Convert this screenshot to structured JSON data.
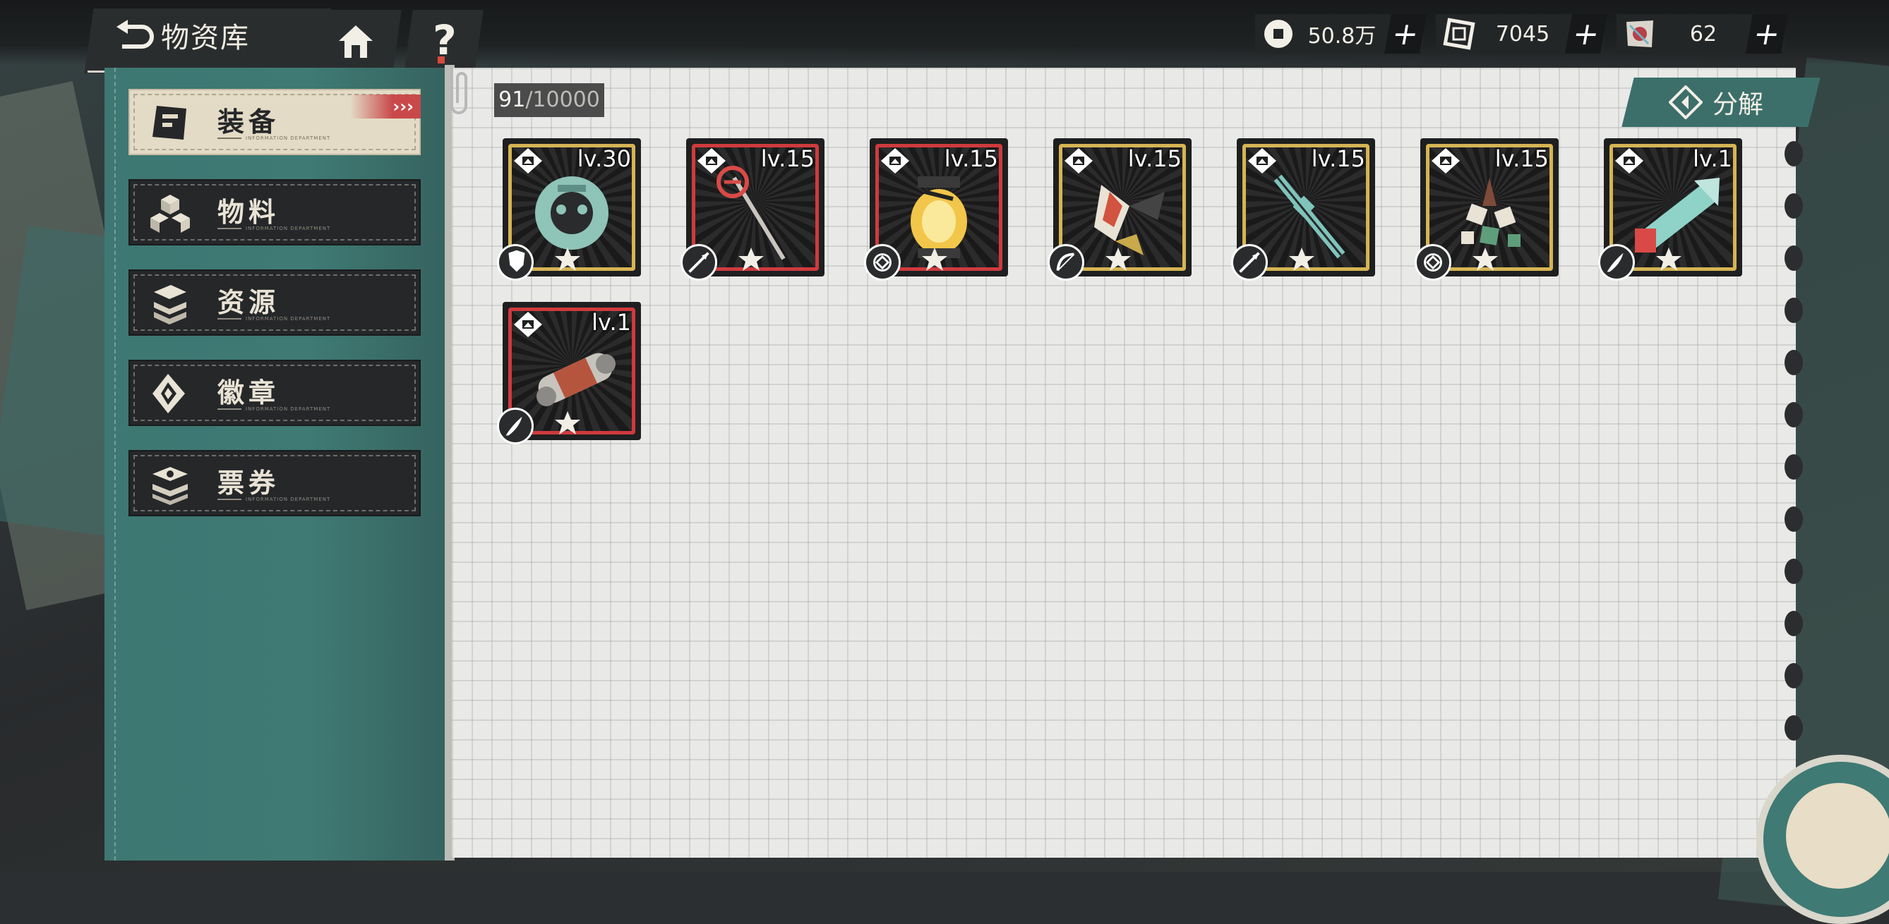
{
  "header": {
    "title": "物资库"
  },
  "currencies": [
    {
      "icon": "coin-icon",
      "value": "50.8万"
    },
    {
      "icon": "chip-icon",
      "value": "7045"
    },
    {
      "icon": "ticket-icon",
      "value": "62"
    }
  ],
  "plus_label": "+",
  "help_label": "?",
  "sidebar": {
    "tabs": [
      {
        "label": "装备",
        "sub": "INFORMATION DEPARTMENT",
        "active": true
      },
      {
        "label": "物料",
        "sub": "INFORMATION DEPARTMENT",
        "active": false
      },
      {
        "label": "资源",
        "sub": "INFORMATION DEPARTMENT",
        "active": false
      },
      {
        "label": "徽章",
        "sub": "INFORMATION DEPARTMENT",
        "active": false
      },
      {
        "label": "票券",
        "sub": "INFORMATION DEPARTMENT",
        "active": false
      }
    ],
    "active_arrows": "›››"
  },
  "inventory": {
    "count": "91",
    "capacity": "/10000",
    "decompose_label": "分解",
    "items": [
      {
        "level": "lv.30",
        "frame": "gold",
        "art": "gear-mask",
        "type": "shield-type-icon"
      },
      {
        "level": "lv.15",
        "frame": "red",
        "art": "staff",
        "type": "spear-type-icon"
      },
      {
        "level": "lv.15",
        "frame": "red",
        "art": "lantern",
        "type": "orb-type-icon"
      },
      {
        "level": "lv.15",
        "frame": "gold",
        "art": "claw",
        "type": "bow-type-icon"
      },
      {
        "level": "lv.15",
        "frame": "gold",
        "art": "rifle",
        "type": "spear-type-icon"
      },
      {
        "level": "lv.15",
        "frame": "gold",
        "art": "shards",
        "type": "orb-type-icon"
      },
      {
        "level": "lv.1",
        "frame": "gold",
        "art": "cannon",
        "type": "brush-type-icon"
      },
      {
        "level": "lv.1",
        "frame": "red",
        "art": "capsule",
        "type": "brush-type-icon"
      }
    ]
  },
  "colors": {
    "sidebar": "#3f7a74",
    "gold_frame": "#d5b453",
    "red_frame": "#cf3a3d",
    "active_tab": "#e4dbc6"
  }
}
